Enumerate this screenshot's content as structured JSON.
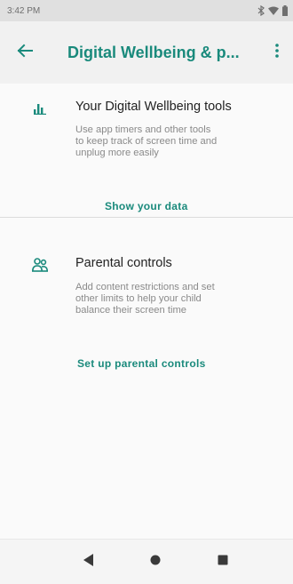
{
  "status_bar": {
    "time": "3:42 PM",
    "icons": [
      "bluetooth-icon",
      "wifi-icon",
      "battery-icon"
    ]
  },
  "app_bar": {
    "title": "Digital Wellbeing & p...",
    "back_icon": "arrow-left-icon",
    "overflow_icon": "more-vert-icon"
  },
  "sections": [
    {
      "icon": "bar-chart-icon",
      "title": "Your Digital Wellbeing tools",
      "description_lines": [
        "Use app timers and other tools",
        "to keep track of screen time and",
        "unplug more easily"
      ],
      "action": "Show your data"
    },
    {
      "icon": "family-icon",
      "title": "Parental controls",
      "description_lines": [
        "Add content restrictions and set",
        "other limits to help your child",
        "balance their screen time"
      ],
      "action": "Set up parental controls"
    }
  ],
  "nav_bar": {
    "buttons": [
      "back-triangle-icon",
      "home-circle-icon",
      "recents-square-icon"
    ]
  },
  "colors": {
    "accent": "#1a8a7c",
    "status_bar": "#e0e0e0",
    "app_bar": "#f1f1f1"
  }
}
